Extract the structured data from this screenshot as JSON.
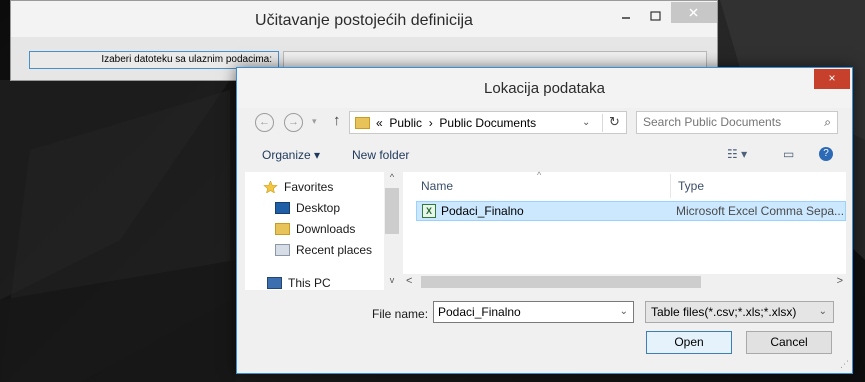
{
  "back_window": {
    "title": "Učitavanje postojećih definicija",
    "minimize_glyph": "–",
    "maximize_glyph": "□",
    "close_glyph": "×",
    "select_file_label": "Izaberi datoteku sa ulaznim podacima:",
    "file_path_value": ""
  },
  "dialog": {
    "title": "Lokacija podataka",
    "close_glyph": "×",
    "nav": {
      "back_glyph": "←",
      "forward_glyph": "→",
      "recent_glyph": "▾",
      "up_glyph": "↑",
      "breadcrumb_prefix": "«",
      "crumb_1": "Public",
      "crumb_sep": "›",
      "crumb_2": "Public Documents",
      "dropdown_glyph": "⌄",
      "refresh_glyph": "↻"
    },
    "search": {
      "placeholder": "Search Public Documents",
      "icon_glyph": "⌕"
    },
    "toolbar": {
      "organize_label": "Organize ▾",
      "new_folder_label": "New folder",
      "view_glyph": "☷ ▾",
      "preview_glyph": "▭",
      "help_glyph": "?"
    },
    "nav_pane": {
      "favorites": "Favorites",
      "items": [
        "Desktop",
        "Downloads",
        "Recent places"
      ],
      "cut_off_item": "This PC"
    },
    "file_list": {
      "columns": [
        "Name",
        "Type"
      ],
      "sort_glyph": "^",
      "rows": [
        {
          "name": "Podaci_Finalno",
          "type": "Microsoft Excel Comma Sepa...",
          "icon": "excel-csv-icon"
        }
      ]
    },
    "scroll": {
      "left": "<",
      "right": ">",
      "up": "^",
      "down": "v"
    },
    "footer": {
      "file_name_label": "File name:",
      "file_name_value": "Podaci_Finalno",
      "file_name_dd": "⌄",
      "file_type_value": "Table files(*.csv;*.xls;*.xlsx)",
      "file_type_dd": "⌄",
      "open_label": "Open",
      "cancel_label": "Cancel",
      "grip_glyph": "⋰"
    }
  }
}
